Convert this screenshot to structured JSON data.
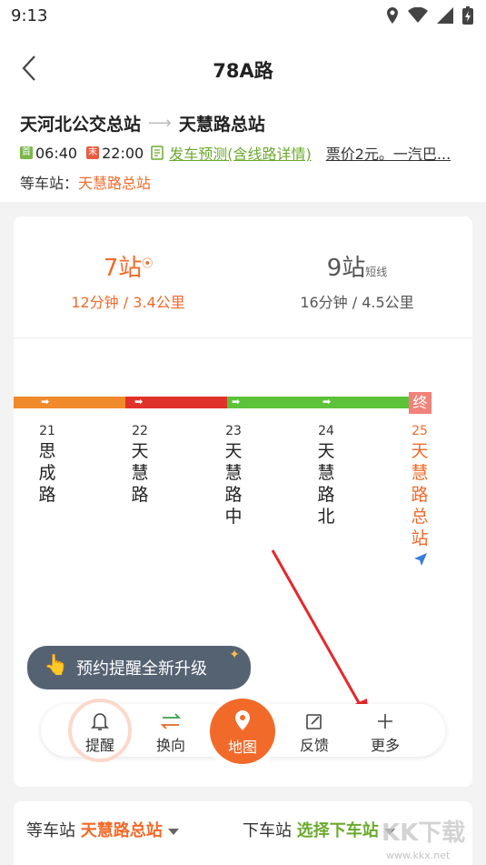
{
  "status": {
    "time": "9:13",
    "icons": [
      "location-icon",
      "wifi-icon",
      "signal-icon",
      "battery-icon"
    ]
  },
  "header": {
    "title": "78A路"
  },
  "route": {
    "from": "天河北公交总站",
    "to": "天慧路总站",
    "first_tag": "首",
    "first_time": "06:40",
    "last_tag": "末",
    "last_time": "22:00",
    "predict_label": "发车预测(含线路详情)",
    "fare": "票价2元。一汽巴...",
    "wait_label": "等车站：",
    "wait_stop": "天慧路总站"
  },
  "stats": {
    "left_count": "7站",
    "left_detail": "12分钟 / 3.4公里",
    "right_count": "9站",
    "right_tag": "短线",
    "right_detail": "16分钟 / 4.5公里"
  },
  "end_badge": "终",
  "stops": [
    {
      "num": "21",
      "name": [
        "思",
        "成",
        "路"
      ]
    },
    {
      "num": "22",
      "name": [
        "天",
        "慧",
        "路"
      ]
    },
    {
      "num": "23",
      "name": [
        "天",
        "慧",
        "路",
        "中"
      ]
    },
    {
      "num": "24",
      "name": [
        "天",
        "慧",
        "路",
        "北"
      ]
    },
    {
      "num": "25",
      "name": [
        "天",
        "慧",
        "路",
        "总",
        "站"
      ]
    }
  ],
  "tooltip": {
    "text": "预约提醒全新升级"
  },
  "toolbar": {
    "remind": "提醒",
    "switch": "换向",
    "map": "地图",
    "feedback": "反馈",
    "more": "更多"
  },
  "bottom": {
    "wait_label": "等车站",
    "wait_value": "天慧路总站",
    "off_label": "下车站",
    "off_value": "选择下车站"
  },
  "watermark": {
    "brand": "KK下载",
    "url": "www.kkx.net"
  },
  "colors": {
    "accent": "#f26a2a",
    "green": "#6aaa2e",
    "red": "#e0312b",
    "orange": "#f08a2a"
  }
}
